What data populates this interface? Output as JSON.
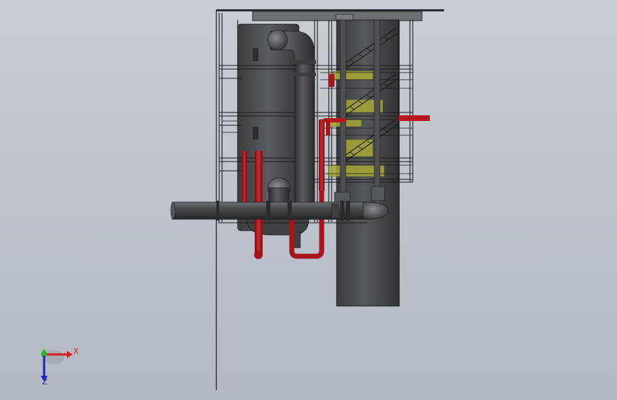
{
  "viewport": {
    "background_top": "#c9cdd4",
    "background_bottom": "#b3b9c2"
  },
  "model": {
    "colors": {
      "steel_dark": "#3a3c3e",
      "steel_mid": "#505356",
      "steel_light": "#6b6e71",
      "pipe_red": "#a8141c",
      "pipe_red_light": "#cc2a30",
      "platform_yellow": "#a8a838",
      "frame_black": "#1a1a1a"
    }
  },
  "triad": {
    "x_label": "X",
    "z_label": "Z",
    "x_color": "#d42020",
    "y_color": "#22b822",
    "z_color": "#2020c8"
  }
}
